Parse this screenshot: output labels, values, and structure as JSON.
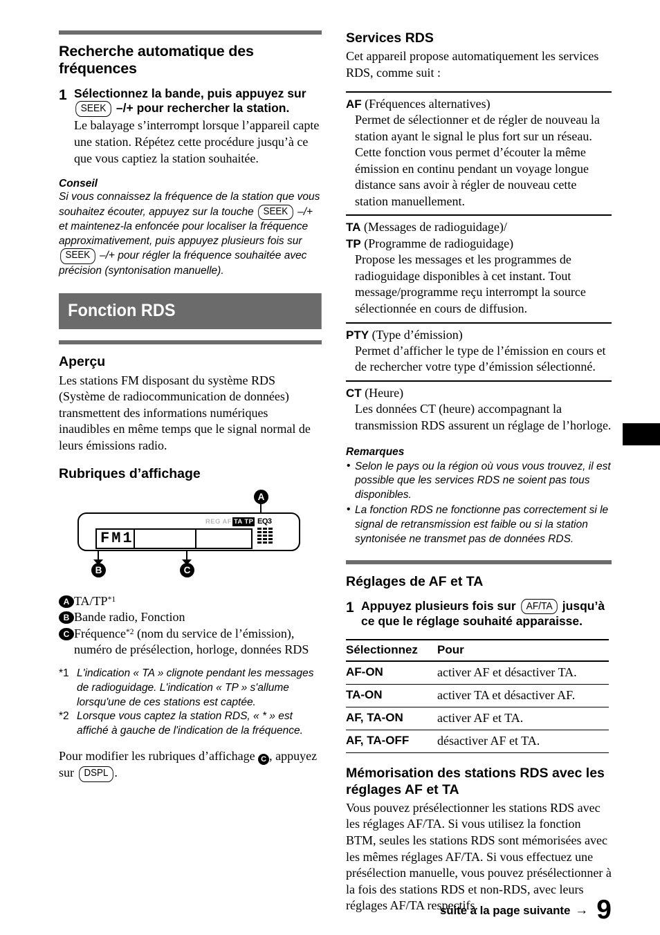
{
  "page": {
    "number": "9",
    "footer_text": "suite à la page suivante",
    "footer_arrow": "→"
  },
  "left_column": {
    "section_title": "Recherche automatique des fréquences",
    "step": {
      "number": "1",
      "title_part1": "Sélectionnez la bande, puis appuyez sur",
      "key_seek": "SEEK",
      "title_part2": "–/+ pour rechercher la station.",
      "description": "Le balayage s’interrompt lorsque l’appareil capte une station. Répétez cette procédure jusqu’à ce que vous captiez la station souhaitée."
    },
    "tip": {
      "heading": "Conseil",
      "text_1": "Si vous connaissez la fréquence de la station que vous souhaitez écouter, appuyez sur la touche",
      "key_seek_1": "SEEK",
      "text_2": "–/+ et maintenez-la enfoncée pour localiser la fréquence approximativement, puis appuyez plusieurs fois sur",
      "key_seek_2": "SEEK",
      "text_3": "–/+ pour régler la fréquence souhaitée avec précision (syntonisation manuelle)."
    },
    "banner": "Fonction RDS",
    "apercu": {
      "heading": "Aperçu",
      "text": "Les stations FM disposant du système RDS (Système de radiocommunication de données) transmettent des informations numériques inaudibles en même temps que le signal normal de leurs émissions radio."
    },
    "rubriques": {
      "heading": "Rubriques d’affichage",
      "display": {
        "band_text": "FM1",
        "flags_dim": "REG AF",
        "flags_highlight": "TA TP",
        "eq_label": "EQ3",
        "marker_a": "A",
        "marker_b": "B",
        "marker_c": "C"
      },
      "legend": [
        {
          "badge": "A",
          "text": "TA/TP*1"
        },
        {
          "badge": "B",
          "text": "Bande radio, Fonction"
        },
        {
          "badge": "C",
          "text": "Fréquence*2 (nom du service de l’émission), numéro de présélection, horloge, données RDS"
        }
      ],
      "footnotes": [
        {
          "mark": "*1",
          "text": "L'indication « TA » clignote pendant les messages de radioguidage. L'indication « TP » s'allume lorsqu'une de ces stations est captée."
        },
        {
          "mark": "*2",
          "text": "Lorsque vous captez la station RDS, « * » est affiché à gauche de l'indication de la fréquence."
        }
      ],
      "closing_text_1": "Pour modifier les rubriques d’affichage",
      "closing_badge": "C",
      "closing_text_2": ", appuyez sur",
      "closing_key": "DSPL",
      "closing_text_3": "."
    }
  },
  "right_column": {
    "services": {
      "heading": "Services RDS",
      "intro": "Cet appareil propose automatiquement les services RDS, comme suit :",
      "items": [
        {
          "abbr": "AF",
          "term": "(Fréquences alternatives)",
          "definition": "Permet de sélectionner et de régler de nouveau la station ayant le signal le plus fort sur un réseau. Cette fonction vous permet d’écouter la même émission en continu pendant un voyage longue distance sans avoir à régler de nouveau cette station manuellement."
        },
        {
          "abbr": "TA",
          "term": "(Messages de radioguidage)/",
          "abbr2": "TP",
          "term2": "(Programme de radioguidage)",
          "definition": "Propose les messages et les programmes de radioguidage disponibles à cet instant. Tout message/programme reçu interrompt la source sélectionnée en cours de diffusion."
        },
        {
          "abbr": "PTY",
          "term": "(Type d’émission)",
          "definition": "Permet d’afficher le type de l’émission en cours et de rechercher votre type d’émission sélectionné."
        },
        {
          "abbr": "CT",
          "term": "(Heure)",
          "definition": "Les données CT (heure) accompagnant la transmission RDS assurent un réglage de l’horloge."
        }
      ]
    },
    "notes": {
      "heading": "Remarques",
      "items": [
        "Selon le pays ou la région où vous vous trouvez, il est possible que les services RDS ne soient pas tous disponibles.",
        "La fonction RDS ne fonctionne pas correctement si le signal de retransmission est faible ou si la station syntonisée ne transmet pas de données RDS."
      ]
    },
    "reglages": {
      "heading": "Réglages de AF et TA",
      "step": {
        "number": "1",
        "text_1": "Appuyez plusieurs fois sur",
        "key": "AF/TA",
        "text_2": "jusqu’à ce que le réglage souhaité apparaisse."
      },
      "table": {
        "headers": [
          "Sélectionnez",
          "Pour"
        ],
        "rows": [
          [
            "AF-ON",
            "activer AF et désactiver TA."
          ],
          [
            "TA-ON",
            "activer TA et désactiver AF."
          ],
          [
            "AF, TA-ON",
            "activer AF et TA."
          ],
          [
            "AF, TA-OFF",
            "désactiver AF et TA."
          ]
        ]
      }
    },
    "memorisation": {
      "heading": "Mémorisation des stations RDS avec les réglages AF et TA",
      "text": "Vous pouvez présélectionner les stations RDS avec les réglages AF/TA. Si vous utilisez la fonction BTM, seules les stations RDS sont mémorisées avec les mêmes réglages AF/TA. Si vous effectuez une présélection manuelle, vous pouvez présélectionner à la fois des stations RDS et non-RDS, avec leurs réglages AF/TA respectifs."
    }
  }
}
